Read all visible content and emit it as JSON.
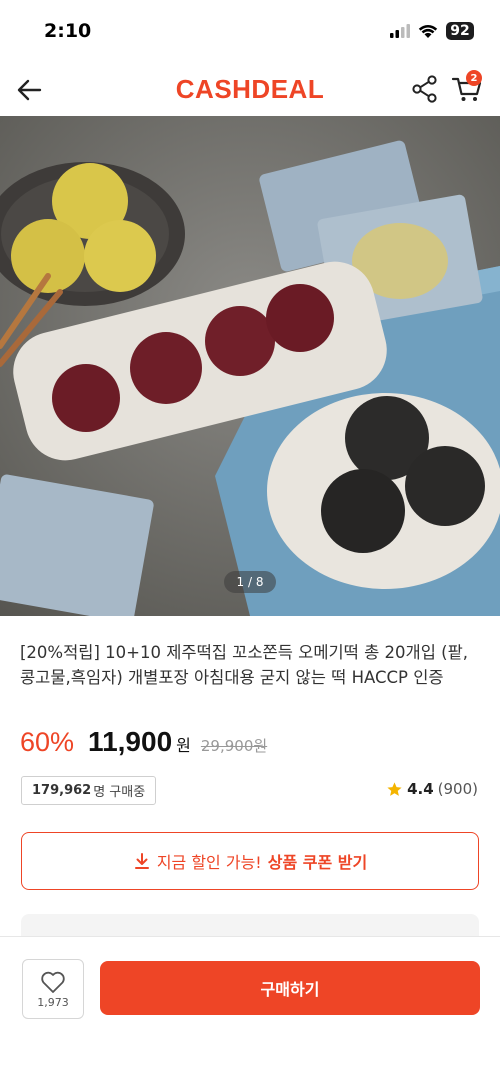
{
  "status_bar": {
    "time": "2:10",
    "battery": "92"
  },
  "header": {
    "brand": "CASHDEAL",
    "cart_badge": "2",
    "icons": {
      "back": "arrow-left-icon",
      "share": "share-icon",
      "cart": "cart-icon"
    }
  },
  "gallery": {
    "counter": "1 / 8"
  },
  "product": {
    "title": "[20%적립] 10+10 제주떡집 꼬소쫀득 오메기떡 총 20개입 (팥,콩고물,흑임자) 개별포장 아침대용 굳지 않는 떡 HACCP 인증",
    "discount": "60%",
    "price": "11,900",
    "currency": "원",
    "original_price": "29,900원",
    "buyers_count": "179,962",
    "buyers_suffix": "명 구매중",
    "rating": "4.4",
    "review_count": "(900)"
  },
  "coupon": {
    "prefix": "지금 할인 가능!",
    "strong": "상품 쿠폰 받기"
  },
  "bottom_bar": {
    "like_count": "1,973",
    "buy_label": "구매하기"
  },
  "colors": {
    "accent": "#ee4526",
    "star": "#f4b400"
  }
}
